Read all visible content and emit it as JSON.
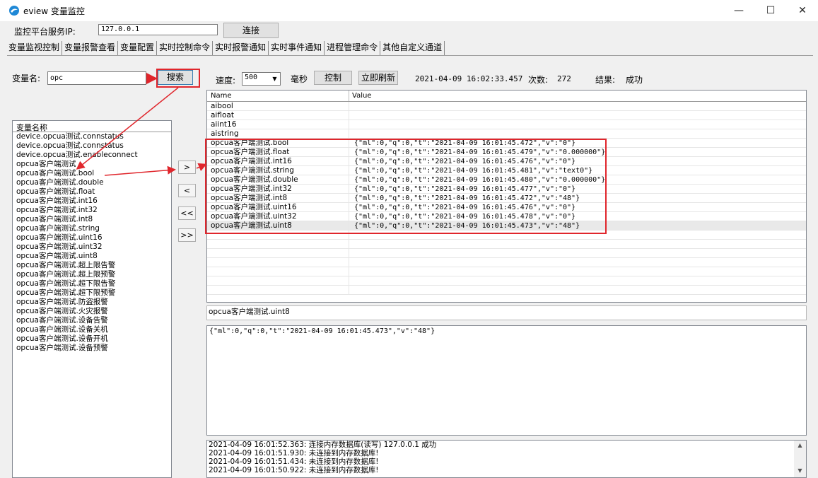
{
  "window": {
    "title": "eview 变量监控",
    "minimize": "—",
    "maximize": "☐",
    "close": "✕",
    "icon": "app-logo-icon"
  },
  "connection": {
    "label": "监控平台服务IP:",
    "ip": "127.0.0.1",
    "connect_label": "连接"
  },
  "tabs": [
    "变量监视控制",
    "变量报警查看",
    "变量配置",
    "实时控制命令",
    "实时报警通知",
    "实时事件通知",
    "进程管理命令",
    "其他自定义通道"
  ],
  "search": {
    "label": "变量名:",
    "value": "opc",
    "button": "搜索"
  },
  "toolbar": {
    "speed_label": "速度:",
    "speed_value": "500",
    "ms_label": "毫秒",
    "control_label": "控制",
    "refresh_label": "立即刷新",
    "timestamp": "2021-04-09 16:02:33.457",
    "count_label": "次数:",
    "count_value": "272",
    "result_label": "结果:",
    "result_value": "成功"
  },
  "left_list": {
    "header": "变量名称",
    "items": [
      "device.opcua测试.connstatus",
      "device.opcua测试.connstatus",
      "device.opcua测试.enableconnect",
      "opcua客户端测试",
      "opcua客户端测试.bool",
      "opcua客户端测试.double",
      "opcua客户端测试.float",
      "opcua客户端测试.int16",
      "opcua客户端测试.int32",
      "opcua客户端测试.int8",
      "opcua客户端测试.string",
      "opcua客户端测试.uint16",
      "opcua客户端测试.uint32",
      "opcua客户端测试.uint8",
      "opcua客户端测试.超上限告警",
      "opcua客户端测试.超上限预警",
      "opcua客户端测试.超下限告警",
      "opcua客户端测试.超下限预警",
      "opcua客户端测试.防盗报警",
      "opcua客户端测试.火灾报警",
      "opcua客户端测试.设备告警",
      "opcua客户端测试.设备关机",
      "opcua客户端测试.设备开机",
      "opcua客户端测试.设备预警"
    ]
  },
  "transfer": {
    "add": ">",
    "remove": "<",
    "remove_all": "<<",
    "add_all": ">>"
  },
  "table": {
    "col_name": "Name",
    "col_value": "Value",
    "rows": [
      {
        "name": "aibool",
        "value": ""
      },
      {
        "name": "aifloat",
        "value": ""
      },
      {
        "name": "aiint16",
        "value": ""
      },
      {
        "name": "aistring",
        "value": ""
      },
      {
        "name": "opcua客户端测试.bool",
        "value": "{\"ml\":0,\"q\":0,\"t\":\"2021-04-09 16:01:45.472\",\"v\":\"0\"}"
      },
      {
        "name": "opcua客户端测试.float",
        "value": "{\"ml\":0,\"q\":0,\"t\":\"2021-04-09 16:01:45.479\",\"v\":\"0.000000\"}"
      },
      {
        "name": "opcua客户端测试.int16",
        "value": "{\"ml\":0,\"q\":0,\"t\":\"2021-04-09 16:01:45.476\",\"v\":\"0\"}"
      },
      {
        "name": "opcua客户端测试.string",
        "value": "{\"ml\":0,\"q\":0,\"t\":\"2021-04-09 16:01:45.481\",\"v\":\"text0\"}"
      },
      {
        "name": "opcua客户端测试.double",
        "value": "{\"ml\":0,\"q\":0,\"t\":\"2021-04-09 16:01:45.480\",\"v\":\"0.000000\"}"
      },
      {
        "name": "opcua客户端测试.int32",
        "value": "{\"ml\":0,\"q\":0,\"t\":\"2021-04-09 16:01:45.477\",\"v\":\"0\"}"
      },
      {
        "name": "opcua客户端测试.int8",
        "value": "{\"ml\":0,\"q\":0,\"t\":\"2021-04-09 16:01:45.472\",\"v\":\"48\"}"
      },
      {
        "name": "opcua客户端测试.uint16",
        "value": "{\"ml\":0,\"q\":0,\"t\":\"2021-04-09 16:01:45.476\",\"v\":\"0\"}"
      },
      {
        "name": "opcua客户端测试.uint32",
        "value": "{\"ml\":0,\"q\":0,\"t\":\"2021-04-09 16:01:45.478\",\"v\":\"0\"}"
      },
      {
        "name": "opcua客户端测试.uint8",
        "value": "{\"ml\":0,\"q\":0,\"t\":\"2021-04-09 16:01:45.473\",\"v\":\"48\"}"
      }
    ],
    "selected_index": 13
  },
  "detail": {
    "selected_name": "opcua客户端测试.uint8",
    "selected_value": "{\"ml\":0,\"q\":0,\"t\":\"2021-04-09 16:01:45.473\",\"v\":\"48\"}"
  },
  "log": {
    "lines": [
      "2021-04-09 16:01:52.363: 连接内存数据库(读写) 127.0.0.1 成功",
      "2021-04-09 16:01:51.930: 未连接到内存数据库!",
      "2021-04-09 16:01:51.434: 未连接到内存数据库!",
      "2021-04-09 16:01:50.922: 未连接到内存数据库!"
    ]
  },
  "colors": {
    "annotation_red": "#e0262c",
    "window_bg": "#f0f0f0"
  }
}
